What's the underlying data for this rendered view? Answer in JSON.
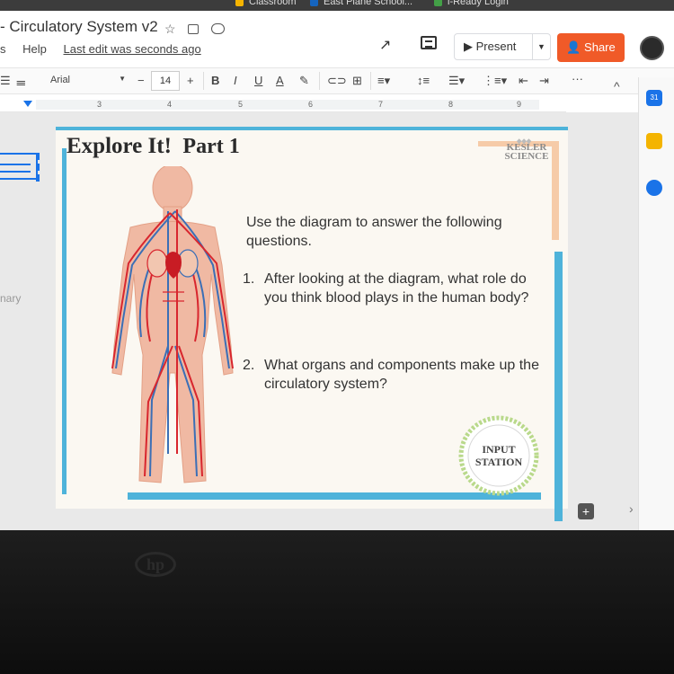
{
  "bookmarks": [
    "Classroom",
    "East Plane School...",
    "i-Ready Login"
  ],
  "doc": {
    "title": "- Circulatory System v2",
    "last_edit": "Last edit was seconds ago"
  },
  "menu": [
    "s",
    "Help"
  ],
  "buttons": {
    "present": "Present",
    "share": "Share"
  },
  "toolbar": {
    "font": "Arial",
    "size": "14",
    "bold": "B",
    "italic": "I",
    "underline": "U",
    "textcolor": "A",
    "minus": "−",
    "plus": "+",
    "more": "···"
  },
  "ruler": [
    "3",
    "4",
    "5",
    "6",
    "7",
    "8",
    "9"
  ],
  "canvas": {
    "side_text": "nary"
  },
  "slide": {
    "title": "Explore It!",
    "part": "Part 1",
    "brand_line1": "KESLER",
    "brand_line2": "SCIENCE",
    "intro": "Use the diagram to answer the following questions.",
    "questions": [
      {
        "num": "1.",
        "text": "After looking at the diagram, what role do you think blood plays in the human body?"
      },
      {
        "num": "2.",
        "text": "What organs and components make up the circulatory system?"
      }
    ],
    "badge_line1": "INPUT",
    "badge_line2": "STATION"
  },
  "rail": {
    "calendar_day": "31"
  },
  "colors": {
    "accent": "#4eb3da",
    "share": "#f05a28",
    "artery": "#d8262e",
    "vein": "#3b6fb6"
  }
}
